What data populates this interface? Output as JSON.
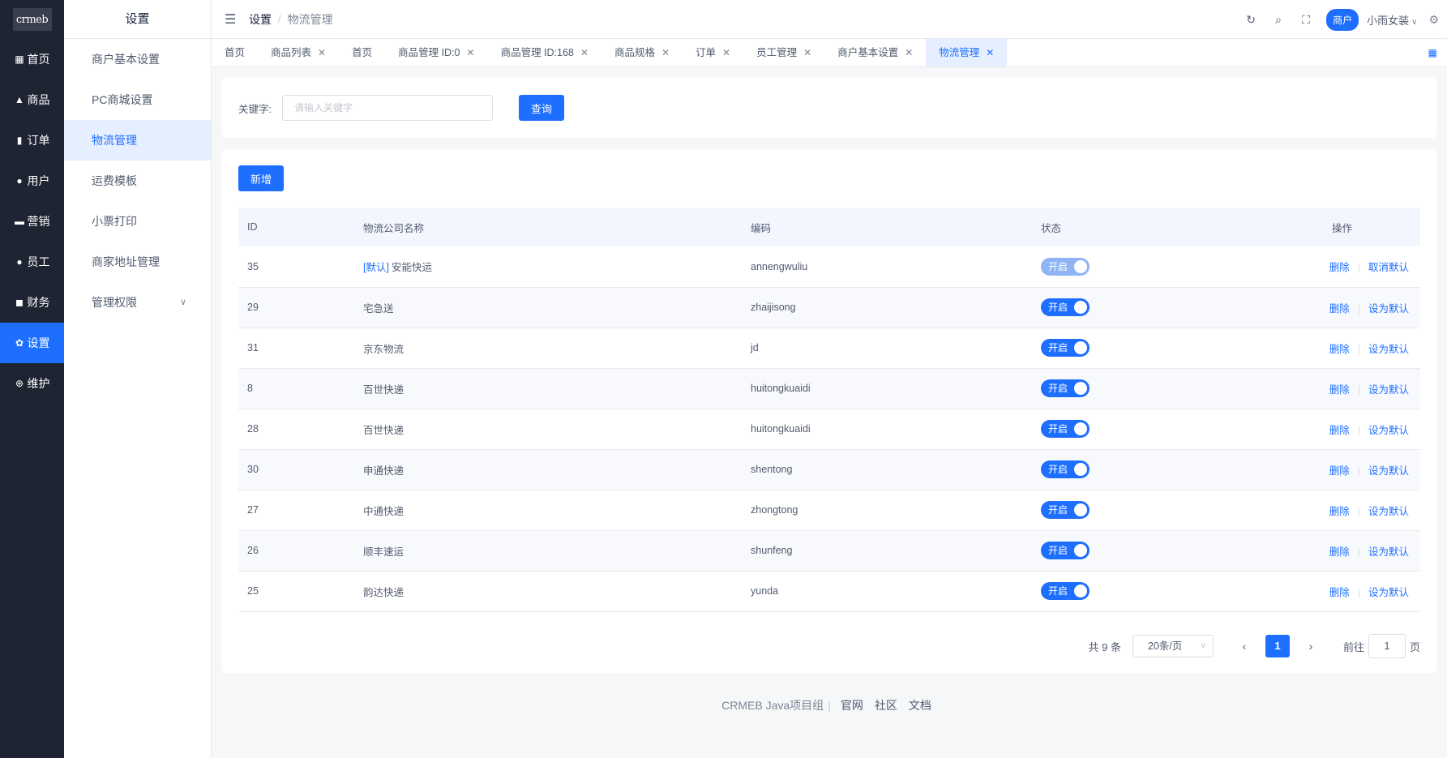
{
  "app": {
    "logo": "crmeb"
  },
  "rail": {
    "items": [
      {
        "icon": "grid-icon",
        "glyph": "▦",
        "label": "首页"
      },
      {
        "icon": "bag-icon",
        "glyph": "▲",
        "label": "商品"
      },
      {
        "icon": "clipboard-icon",
        "glyph": "▮",
        "label": "订单"
      },
      {
        "icon": "user-icon",
        "glyph": "●",
        "label": "用户"
      },
      {
        "icon": "marketing-icon",
        "glyph": "▬",
        "label": "营销"
      },
      {
        "icon": "staff-icon",
        "glyph": "●",
        "label": "员工"
      },
      {
        "icon": "wallet-icon",
        "glyph": "◼",
        "label": "财务"
      },
      {
        "icon": "settings-icon",
        "glyph": "✿",
        "label": "设置",
        "active": true
      },
      {
        "icon": "maintenance-icon",
        "glyph": "⊕",
        "label": "维护"
      }
    ]
  },
  "submenu": {
    "title": "设置",
    "items": [
      {
        "label": "商户基本设置"
      },
      {
        "label": "PC商城设置"
      },
      {
        "label": "物流管理",
        "active": true
      },
      {
        "label": "运费模板"
      },
      {
        "label": "小票打印"
      },
      {
        "label": "商家地址管理"
      },
      {
        "label": "管理权限",
        "expandable": true
      }
    ]
  },
  "header": {
    "breadcrumb_current": "设置",
    "breadcrumb_sep": "/",
    "breadcrumb_last": "物流管理",
    "merchant_badge": "商户",
    "username": "小雨女装"
  },
  "tabs": [
    {
      "label": "首页",
      "closable": false
    },
    {
      "label": "商品列表",
      "closable": true
    },
    {
      "label": "首页",
      "closable": false
    },
    {
      "label": "商品管理 ID:0",
      "closable": true
    },
    {
      "label": "商品管理 ID:168",
      "closable": true
    },
    {
      "label": "商品规格",
      "closable": true
    },
    {
      "label": "订单",
      "closable": true
    },
    {
      "label": "员工管理",
      "closable": true
    },
    {
      "label": "商户基本设置",
      "closable": true
    },
    {
      "label": "物流管理",
      "closable": true,
      "active": true
    }
  ],
  "search": {
    "label": "关键字:",
    "placeholder": "请输入关键字",
    "value": "",
    "button": "查询"
  },
  "toolbar": {
    "add_label": "新增"
  },
  "table": {
    "columns": [
      "ID",
      "物流公司名称",
      "编码",
      "状态",
      "操作"
    ],
    "default_tag": "[默认]",
    "switch_on": "开启",
    "delete_label": "删除",
    "op_sep": "|",
    "rows": [
      {
        "id": "35",
        "name": "安能快运",
        "code": "annengwuliu",
        "is_default": true,
        "op2": "取消默认"
      },
      {
        "id": "29",
        "name": "宅急送",
        "code": "zhaijisong",
        "is_default": false,
        "op2": "设为默认"
      },
      {
        "id": "31",
        "name": "京东物流",
        "code": "jd",
        "is_default": false,
        "op2": "设为默认"
      },
      {
        "id": "8",
        "name": "百世快递",
        "code": "huitongkuaidi",
        "is_default": false,
        "op2": "设为默认"
      },
      {
        "id": "28",
        "name": "百世快递",
        "code": "huitongkuaidi",
        "is_default": false,
        "op2": "设为默认"
      },
      {
        "id": "30",
        "name": "申通快递",
        "code": "shentong",
        "is_default": false,
        "op2": "设为默认"
      },
      {
        "id": "27",
        "name": "中通快递",
        "code": "zhongtong",
        "is_default": false,
        "op2": "设为默认"
      },
      {
        "id": "26",
        "name": "顺丰速运",
        "code": "shunfeng",
        "is_default": false,
        "op2": "设为默认"
      },
      {
        "id": "25",
        "name": "韵达快递",
        "code": "yunda",
        "is_default": false,
        "op2": "设为默认"
      }
    ]
  },
  "pagination": {
    "total": "共 9 条",
    "page_size": "20条/页",
    "current_page": "1",
    "goto_label": "前往",
    "goto_value": "1",
    "page_unit": "页"
  },
  "footer": {
    "brand": "CRMEB Java项目组",
    "links": [
      "官网",
      "社区",
      "文档"
    ]
  }
}
